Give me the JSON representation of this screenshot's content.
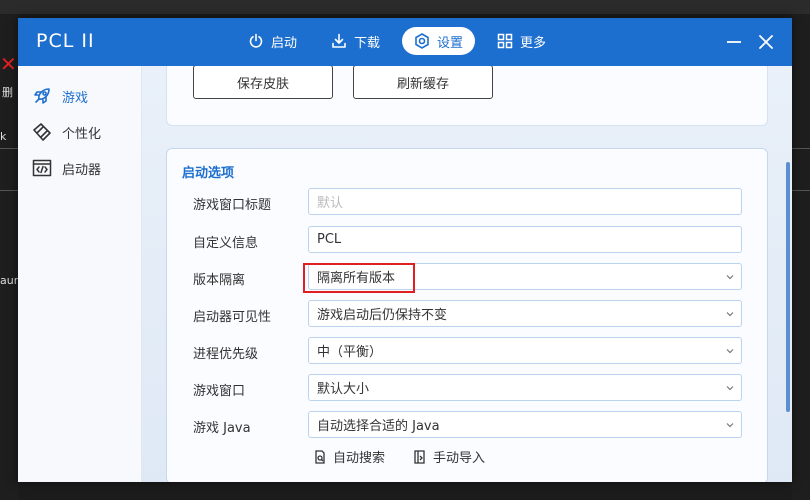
{
  "window": {
    "title": "PCL II"
  },
  "nav": {
    "items": [
      {
        "label": "启动",
        "icon": "power-icon"
      },
      {
        "label": "下载",
        "icon": "download-icon"
      },
      {
        "label": "设置",
        "icon": "gear-icon",
        "active": true
      },
      {
        "label": "更多",
        "icon": "grid-icon"
      }
    ]
  },
  "sidebar": {
    "items": [
      {
        "label": "游戏",
        "icon": "rocket-icon",
        "active": true
      },
      {
        "label": "个性化",
        "icon": "brush-icon"
      },
      {
        "label": "启动器",
        "icon": "code-window-icon"
      }
    ]
  },
  "top_card": {
    "save_skin": "保存皮肤",
    "refresh_cache": "刷新缓存"
  },
  "launch_options": {
    "title": "启动选项",
    "rows": [
      {
        "label": "游戏窗口标题",
        "value": "",
        "placeholder": "默认"
      },
      {
        "label": "自定义信息",
        "value": "PCL"
      },
      {
        "label": "版本隔离",
        "value": "隔离所有版本"
      },
      {
        "label": "启动器可见性",
        "value": "游戏启动后仍保持不变"
      },
      {
        "label": "进程优先级",
        "value": "中（平衡）"
      },
      {
        "label": "游戏窗口",
        "value": "默认大小"
      },
      {
        "label": "游戏 Java",
        "value": "自动选择合适的 Java"
      }
    ],
    "auto_search": "自动搜索",
    "manual_import": "手动导入"
  },
  "background": {
    "fragment_1": "删",
    "fragment_2": "k",
    "fragment_3": "aun"
  },
  "colors": {
    "accent": "#1d6fcf",
    "highlight_box": "#e02020"
  }
}
